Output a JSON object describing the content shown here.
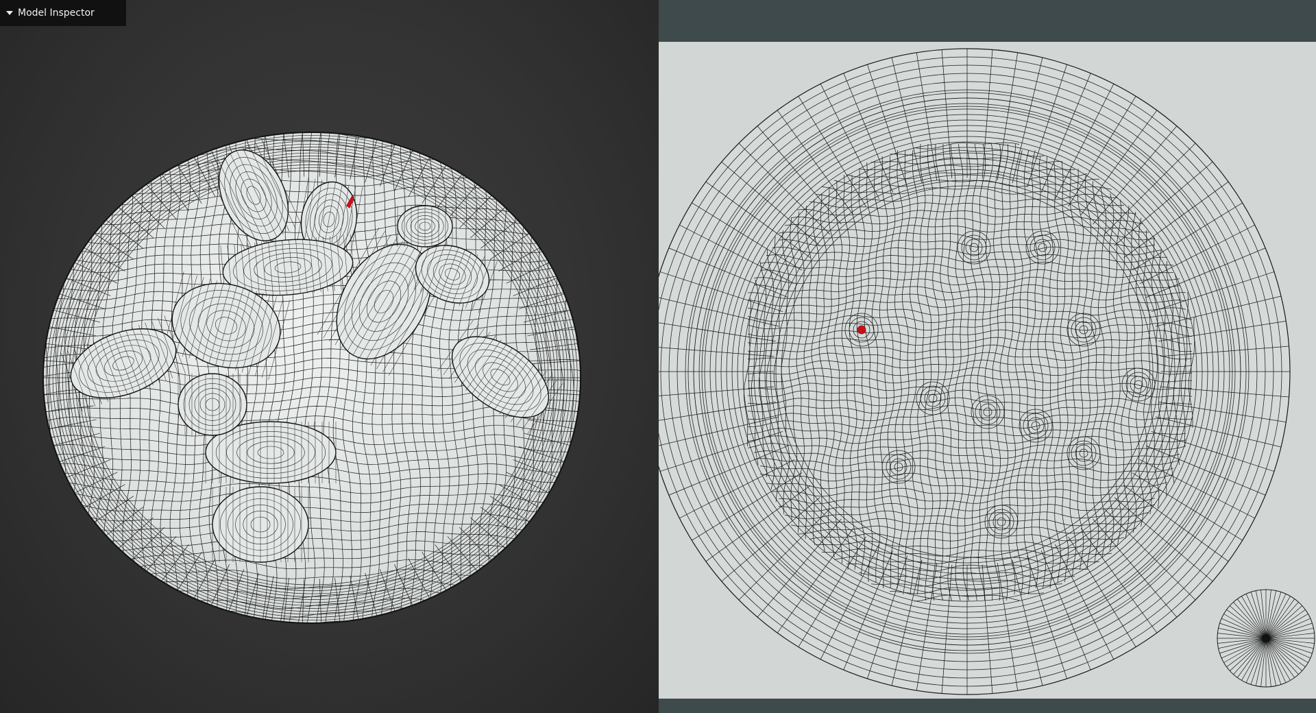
{
  "inspector": {
    "title": "Model Inspector",
    "toggle_icon": "caret-down-icon",
    "expanded": true
  },
  "viewport": {
    "background_color": "#333333",
    "mesh_fill": "#e2e6e5",
    "wire_color": "#1a1a1a",
    "selection_color": "#c8101a"
  },
  "uv_editor": {
    "frame_color": "#3e4a4b",
    "canvas_color": "#d2d7d6",
    "wire_color": "#1a1a1a",
    "selection_color": "#c8101a"
  }
}
